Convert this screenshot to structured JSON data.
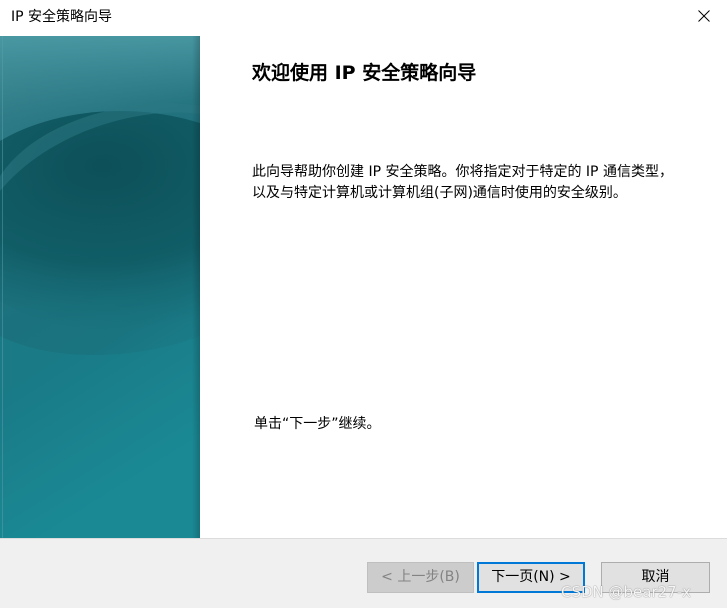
{
  "window": {
    "title": "IP 安全策略向导"
  },
  "content": {
    "heading": "欢迎使用 IP 安全策略向导",
    "description": "此向导帮助你创建 IP 安全策略。你将指定对于特定的 IP 通信类型，以及与特定计算机或计算机组(子网)通信时使用的安全级别。",
    "continue_text": "单击“下一步”继续。"
  },
  "buttons": {
    "back_label": "< 上一步(B)",
    "next_label": "下一页(N) >",
    "cancel_label": "取消"
  },
  "watermark": {
    "text": "CSDN @bear27-x"
  },
  "colors": {
    "panel_top": "#3a8590",
    "panel_mid": "#1a6a75",
    "panel_bottom": "#1b8a95",
    "footer": "#f0f0f0",
    "accent": "#0078d7"
  },
  "icons": {
    "close": "close-icon"
  }
}
